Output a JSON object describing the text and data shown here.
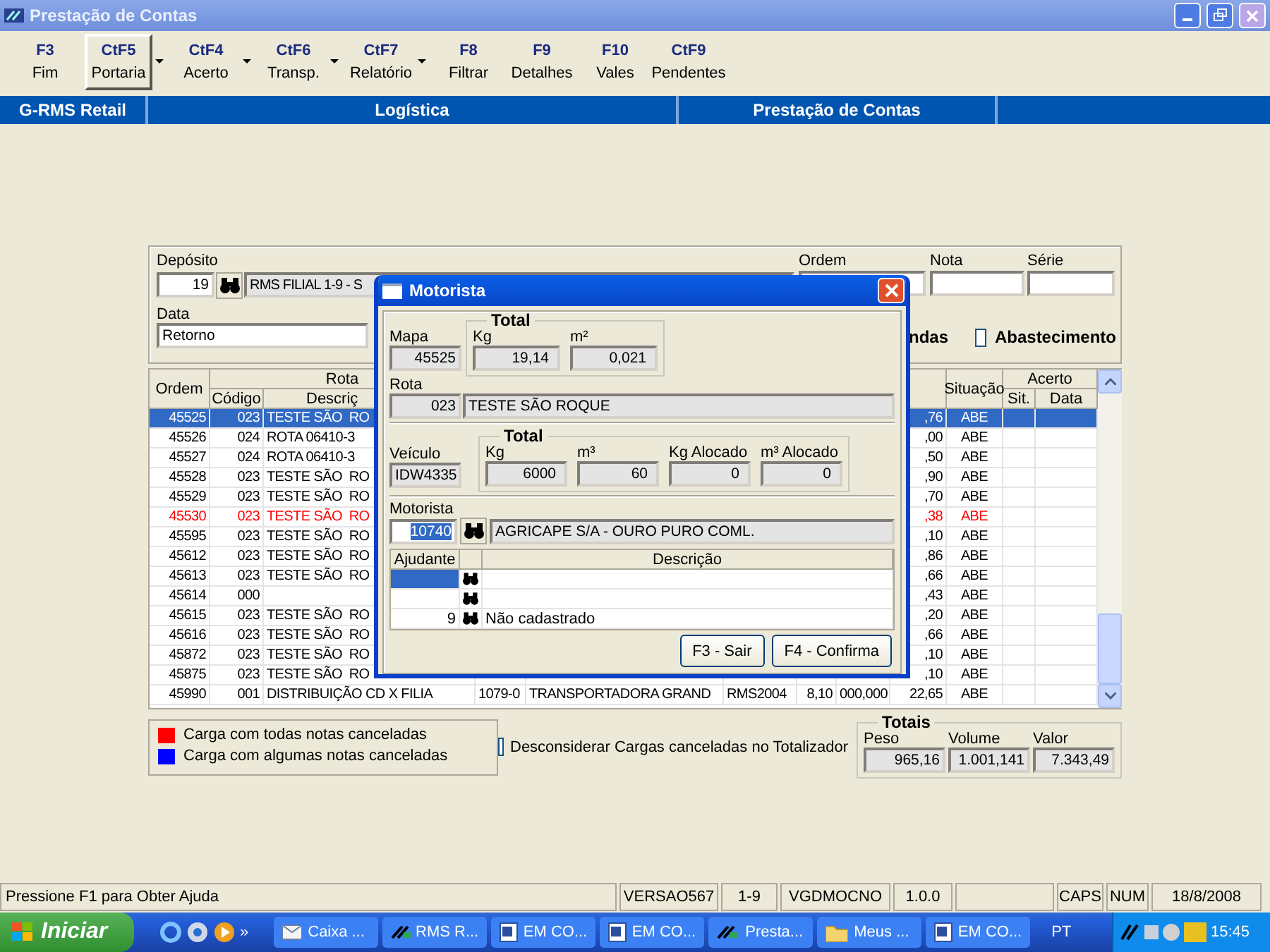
{
  "window": {
    "title": "Prestação de Contas"
  },
  "toolbar": [
    {
      "key": "F3",
      "label": "Fim",
      "selected": false,
      "dropdown": false
    },
    {
      "key": "CtF5",
      "label": "Portaria",
      "selected": true,
      "dropdown": true
    },
    {
      "key": "CtF4",
      "label": "Acerto",
      "selected": false,
      "dropdown": true
    },
    {
      "key": "CtF6",
      "label": "Transp.",
      "selected": false,
      "dropdown": true
    },
    {
      "key": "CtF7",
      "label": "Relatório",
      "selected": false,
      "dropdown": true
    },
    {
      "key": "F8",
      "label": "Filtrar",
      "selected": false,
      "dropdown": false
    },
    {
      "key": "F9",
      "label": "Detalhes",
      "selected": false,
      "dropdown": false
    },
    {
      "key": "F10",
      "label": "Vales",
      "selected": false,
      "dropdown": false
    },
    {
      "key": "CtF9",
      "label": "Pendentes",
      "selected": false,
      "dropdown": false
    }
  ],
  "header_bar": [
    "G-RMS Retail",
    "Logística",
    "Prestação de Contas"
  ],
  "filter": {
    "deposito_label": "Depósito",
    "deposito_code": "19",
    "deposito_name": "RMS FILIAL 1-9 - S",
    "data_label": "Data",
    "data_value": "Retorno",
    "ordem_label": "Ordem",
    "nota_label": "Nota",
    "serie_label": "Série",
    "column_text": "ndas",
    "abastecimento": {
      "label": "Abastecimento",
      "checked": false
    }
  },
  "table": {
    "headers": {
      "ordem": "Ordem",
      "rota": "Rota",
      "codigo": "Código",
      "descricao": "Descriç",
      "situacao": "Situação",
      "acerto": "Acerto",
      "sit": "Sit.",
      "data": "Data"
    },
    "rows": [
      {
        "ordem": "45525",
        "codigo": "023",
        "descricao": "TESTE SÃO  RO",
        "valor": ",76",
        "situacao": "ABE",
        "selected": true,
        "canceled": false
      },
      {
        "ordem": "45526",
        "codigo": "024",
        "descricao": "ROTA 06410-3",
        "valor": ",00",
        "situacao": "ABE",
        "selected": false,
        "canceled": false
      },
      {
        "ordem": "45527",
        "codigo": "024",
        "descricao": "ROTA 06410-3",
        "valor": ",50",
        "situacao": "ABE",
        "selected": false,
        "canceled": false
      },
      {
        "ordem": "45528",
        "codigo": "023",
        "descricao": "TESTE SÃO  RO",
        "valor": ",90",
        "situacao": "ABE",
        "selected": false,
        "canceled": false
      },
      {
        "ordem": "45529",
        "codigo": "023",
        "descricao": "TESTE SÃO  RO",
        "valor": ",70",
        "situacao": "ABE",
        "selected": false,
        "canceled": false
      },
      {
        "ordem": "45530",
        "codigo": "023",
        "descricao": "TESTE SÃO  RO",
        "valor": ",38",
        "situacao": "ABE",
        "selected": false,
        "canceled": true
      },
      {
        "ordem": "45595",
        "codigo": "023",
        "descricao": "TESTE SÃO  RO",
        "valor": ",10",
        "situacao": "ABE",
        "selected": false,
        "canceled": false
      },
      {
        "ordem": "45612",
        "codigo": "023",
        "descricao": "TESTE SÃO  RO",
        "valor": ",86",
        "situacao": "ABE",
        "selected": false,
        "canceled": false
      },
      {
        "ordem": "45613",
        "codigo": "023",
        "descricao": "TESTE SÃO  RO",
        "valor": ",66",
        "situacao": "ABE",
        "selected": false,
        "canceled": false
      },
      {
        "ordem": "45614",
        "codigo": "000",
        "valor": ",43",
        "situacao": "ABE",
        "selected": false,
        "canceled": false
      },
      {
        "ordem": "45615",
        "codigo": "023",
        "descricao": "TESTE SÃO  RO",
        "valor": ",20",
        "situacao": "ABE",
        "selected": false,
        "canceled": false
      },
      {
        "ordem": "45616",
        "codigo": "023",
        "descricao": "TESTE SÃO  RO",
        "valor": ",66",
        "situacao": "ABE",
        "selected": false,
        "canceled": false
      },
      {
        "ordem": "45872",
        "codigo": "023",
        "descricao": "TESTE SÃO  RO",
        "valor": ",10",
        "situacao": "ABE",
        "selected": false,
        "canceled": false
      },
      {
        "ordem": "45875",
        "codigo": "023",
        "descricao": "TESTE SÃO  RO",
        "valor": ",10",
        "situacao": "ABE",
        "selected": false,
        "canceled": false
      },
      {
        "ordem": "45990",
        "codigo": "001",
        "descricao": "DISTRIBUIÇÃO CD X FILIA",
        "column_4": "1079-0",
        "column_5": "TRANSPORTADORA GRAND",
        "column_6": "RMS2004",
        "column_7": "8,10",
        "column_8": "000,000",
        "valor": "22,65",
        "situacao": "ABE",
        "selected": false,
        "canceled": false
      }
    ]
  },
  "legend": [
    {
      "label": "Carga com todas notas canceladas",
      "color": "#ff0000"
    },
    {
      "label": "Carga com algumas notas canceladas",
      "color": "#0000ff"
    }
  ],
  "desconsiderar": {
    "label": "Desconsiderar Cargas canceladas no Totalizador",
    "checked": false
  },
  "totais": {
    "title": "Totais",
    "fields": [
      {
        "label": "Peso",
        "value": "965,16"
      },
      {
        "label": "Volume",
        "value": "1.001,141"
      },
      {
        "label": "Valor",
        "value": "7.343,49"
      }
    ]
  },
  "dialog": {
    "title": "Motorista",
    "mapa_label": "Mapa",
    "mapa": "45525",
    "total1": {
      "title": "Total",
      "fields": [
        {
          "label": "Kg",
          "value": "19,14"
        },
        {
          "label": "m²",
          "value": "0,021"
        }
      ]
    },
    "rota_label": "Rota",
    "rota_code": "023",
    "rota_name": "TESTE SÃO  ROQUE",
    "veiculo_label": "Veículo",
    "veiculo": "IDW4335",
    "total2": {
      "title": "Total",
      "fields": [
        {
          "label": "Kg",
          "value": "6000"
        },
        {
          "label": "m³",
          "value": "60"
        },
        {
          "label": "Kg Alocado",
          "value": "0"
        },
        {
          "label": "m³ Alocado",
          "value": "0"
        }
      ]
    },
    "motorista_label": "Motorista",
    "motorista_code": "10740",
    "motorista_name": "AGRICAPE S/A - OURO PURO COML.",
    "grid": {
      "headers": [
        "Ajudante",
        "Descrição"
      ],
      "rows": [
        {
          "selected": true
        },
        {
          "selected": false
        },
        {
          "ajudante": "9",
          "descricao": "Não cadastrado",
          "selected": false
        }
      ]
    },
    "buttons": [
      "F3 - Sair",
      "F4 - Confirma"
    ]
  },
  "status_bar": [
    "Pressione F1 para Obter Ajuda",
    "VERSAO567",
    "1-9",
    "VGDMOCNO",
    "1.0.0",
    "CAPS",
    "NUM",
    "18/8/2008"
  ],
  "taskbar": {
    "start": "Iniciar",
    "more": "»",
    "tasks": [
      {
        "label": "Caixa ...",
        "kind": "mail"
      },
      {
        "label": "RMS R...",
        "kind": "app"
      },
      {
        "label": "EM CO...",
        "kind": "doc"
      },
      {
        "label": "EM CO...",
        "kind": "doc"
      },
      {
        "label": "Presta...",
        "kind": "app"
      },
      {
        "label": "Meus ...",
        "kind": "folder"
      },
      {
        "label": "EM CO...",
        "kind": "doc"
      }
    ],
    "language": "PT",
    "clock": "15:45"
  }
}
